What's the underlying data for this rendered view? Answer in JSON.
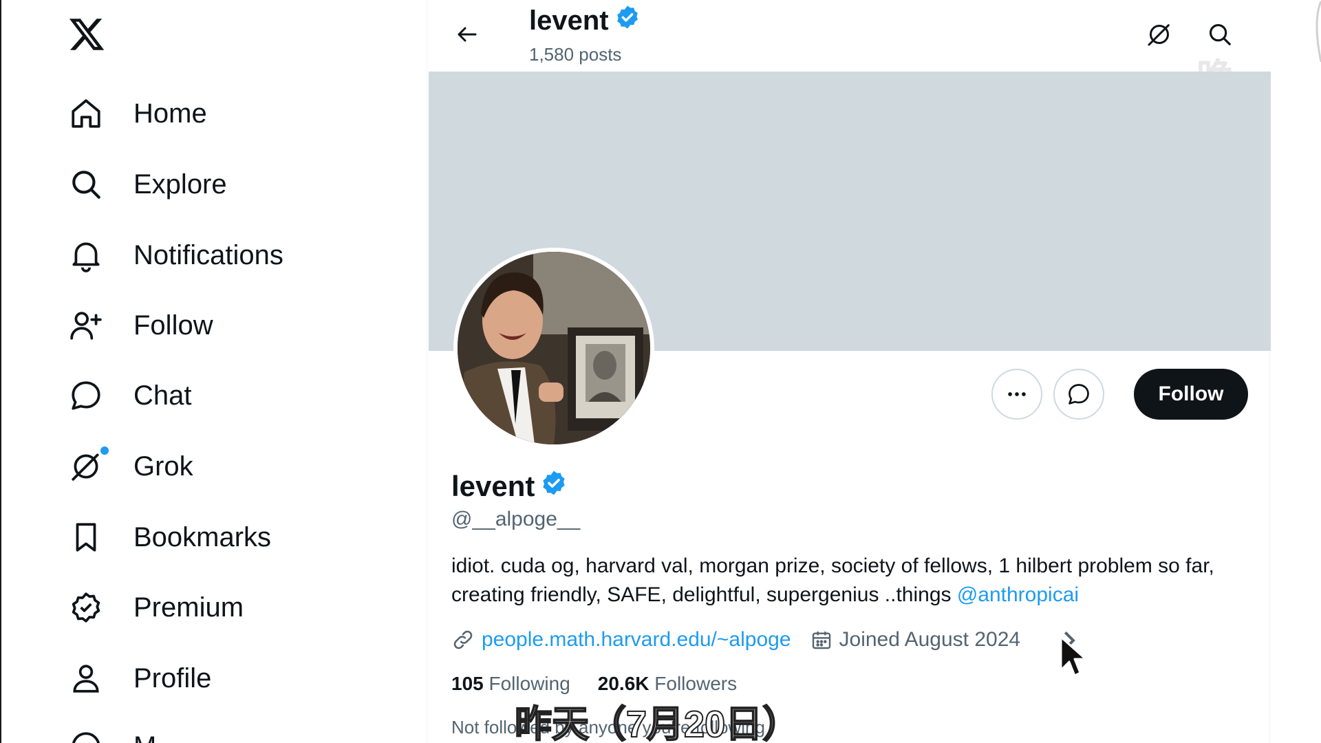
{
  "sidebar": {
    "logo": "x-logo",
    "items": [
      {
        "label": "Home",
        "icon": "home-icon"
      },
      {
        "label": "Explore",
        "icon": "search-icon"
      },
      {
        "label": "Notifications",
        "icon": "bell-icon"
      },
      {
        "label": "Follow",
        "icon": "person-plus-icon"
      },
      {
        "label": "Chat",
        "icon": "chat-bubble-icon"
      },
      {
        "label": "Grok",
        "icon": "grok-icon"
      },
      {
        "label": "Bookmarks",
        "icon": "bookmark-icon"
      },
      {
        "label": "Premium",
        "icon": "premium-badge-icon"
      },
      {
        "label": "Profile",
        "icon": "person-icon"
      },
      {
        "label": "M",
        "icon": "more-icon"
      }
    ]
  },
  "header": {
    "title": "levent",
    "posts": "1,580 posts"
  },
  "watermark": "晚点",
  "profile": {
    "name": "levent",
    "handle": "@__alpoge__",
    "bio_text": "idiot. cuda og, harvard val, morgan prize, society of fellows, 1 hilbert problem so far, creating friendly, SAFE, delightful, supergenius ..things ",
    "bio_mention": "@anthropicai",
    "website": "people.math.harvard.edu/~alpoge",
    "joined": "Joined August 2024",
    "following_count": "105",
    "following_label": "Following",
    "followers_count": "20.6K",
    "followers_label": "Followers",
    "not_followed": "Not followed by anyone you're following",
    "follow_button": "Follow"
  },
  "subtitle": "昨天（7月20日）",
  "colors": {
    "accent": "#1d9bf0",
    "banner": "#cfd9de",
    "text": "#0f1419",
    "secondary": "#536471"
  }
}
